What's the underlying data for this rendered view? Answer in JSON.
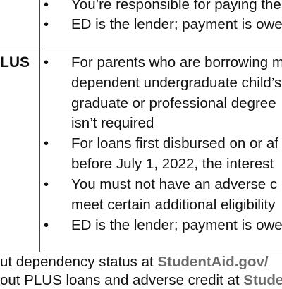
{
  "rows": [
    {
      "label": "",
      "bullets": [
        [
          "You’re responsible for paying the"
        ],
        [
          "ED is the lender; payment is owe"
        ]
      ]
    },
    {
      "label": "LUS",
      "bullets": [
        [
          "For parents who are borrowing m",
          "dependent undergraduate child’s",
          "graduate or professional degree",
          "isn’t required"
        ],
        [
          "For loans first disbursed on or af",
          "before July 1, 2022, the interest"
        ],
        [
          "You must not have an adverse c",
          "meet certain additional eligibility"
        ],
        [
          "ED is the lender; payment is owe"
        ]
      ]
    }
  ],
  "footer": [
    {
      "text": "ut dependency status at ",
      "link": "StudentAid.gov/"
    },
    {
      "text": "out PLUS loans and adverse credit at ",
      "link": "Stude"
    }
  ]
}
